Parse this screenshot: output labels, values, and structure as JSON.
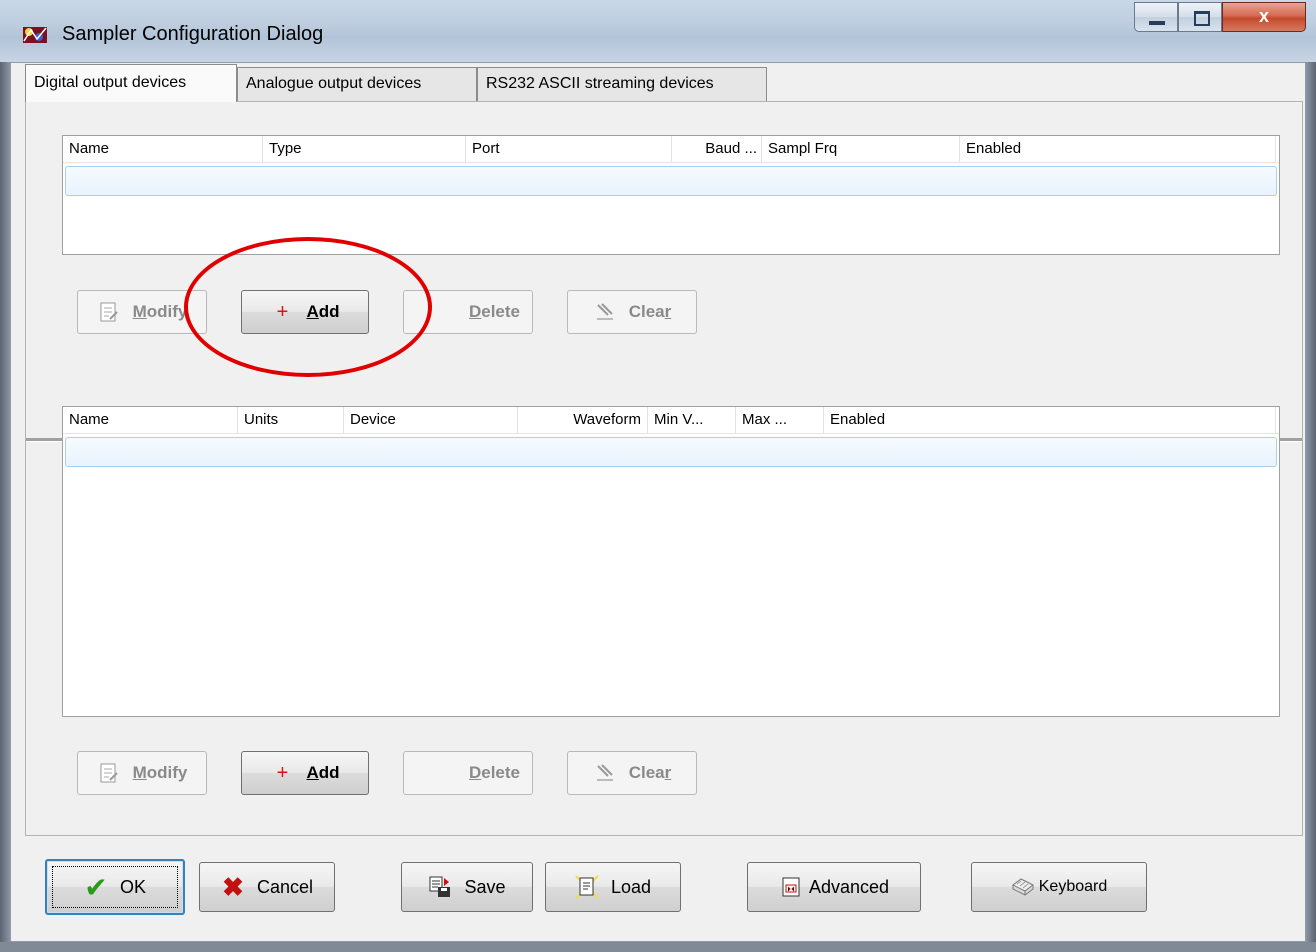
{
  "window": {
    "title": "Sampler Configuration Dialog",
    "close_glyph": "x",
    "icons": {
      "app": "sampler-app-icon",
      "minimize": "minimize-icon",
      "maximize": "maximize-icon",
      "close": "close-icon"
    }
  },
  "tabs": [
    {
      "label": "Digital output devices",
      "active": true
    },
    {
      "label": "Analogue output devices",
      "active": false
    },
    {
      "label": "RS232 ASCII streaming devices",
      "active": false
    }
  ],
  "devices_list": {
    "columns": [
      "Name",
      "Type",
      "Port",
      "Baud ...",
      "Sampl Frq",
      "Enabled"
    ]
  },
  "devices_buttons": {
    "modify": "Modify",
    "add": "Add",
    "delete": "Delete",
    "clear": "Clear"
  },
  "channels_list": {
    "columns": [
      "Name",
      "Units",
      "Device",
      "Waveform",
      "Min V...",
      "Max ...",
      "Enabled"
    ]
  },
  "channels_buttons": {
    "modify": "Modify",
    "add": "Add",
    "delete": "Delete",
    "clear": "Clear"
  },
  "footer": {
    "ok": "OK",
    "cancel": "Cancel",
    "save": "Save",
    "load": "Load",
    "advanced": "Advanced",
    "keyboard": "Keyboard"
  },
  "annotation_color": "#e00000"
}
